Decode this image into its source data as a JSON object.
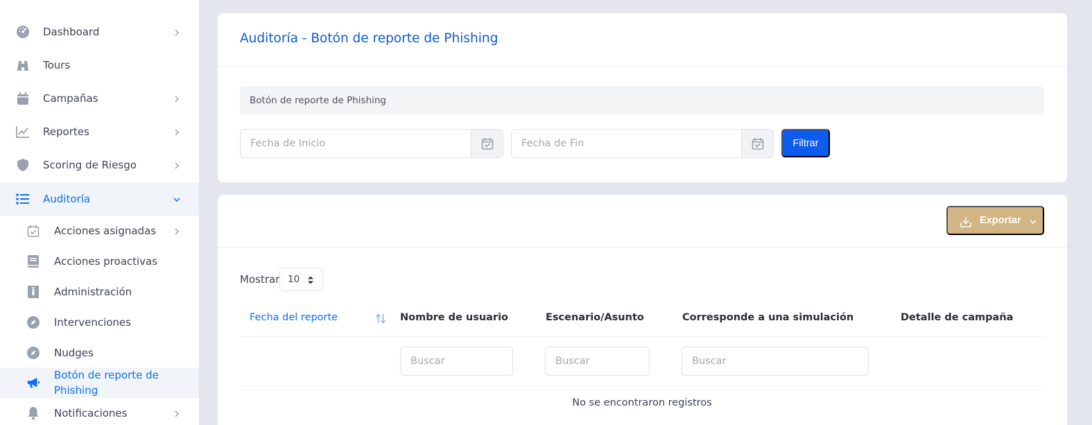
{
  "sidebar": {
    "items": [
      {
        "label": "Dashboard",
        "icon": "gauge-icon"
      },
      {
        "label": "Tours",
        "icon": "binoculars-icon"
      },
      {
        "label": "Campañas",
        "icon": "calendar-icon"
      },
      {
        "label": "Reportes",
        "icon": "line-chart-icon"
      },
      {
        "label": "Scoring de Riesgo",
        "icon": "shield-icon"
      },
      {
        "label": "Auditoría",
        "icon": "list-icon"
      }
    ],
    "subitems": [
      {
        "label": "Acciones asignadas",
        "icon": "calendar-check-icon"
      },
      {
        "label": "Acciones proactivas",
        "icon": "book-icon"
      },
      {
        "label": "Administración",
        "icon": "tie-icon"
      },
      {
        "label": "Intervenciones",
        "icon": "compass-icon"
      },
      {
        "label": "Nudges",
        "icon": "compass-icon"
      },
      {
        "label": "Botón de reporte de Phishing",
        "line1": "Botón de reporte de",
        "line2": "Phishing",
        "icon": "megaphone-icon"
      },
      {
        "label": "Notificaciones",
        "icon": "bell-icon"
      }
    ]
  },
  "header": {
    "title": "Auditoría - Botón de reporte de Phishing"
  },
  "filters": {
    "module_value": "Botón de reporte de Phishing",
    "start_placeholder": "Fecha de Inicio",
    "end_placeholder": "Fecha de Fin",
    "filter_button": "Filtrar"
  },
  "table_card": {
    "export_button": "Exportar",
    "show_label": "Mostrar",
    "page_length": "10",
    "columns": [
      "Fecha del reporte",
      "Nombre de usuario",
      "Escenario/Asunto",
      "Corresponde a una simulación",
      "Detalle de campaña"
    ],
    "search_placeholder": "Buscar",
    "empty_message": "No se encontraron registros"
  },
  "colors": {
    "accent": "#0d6efd",
    "filter_button": "#0d5cf0",
    "export_button": "#d1b584",
    "background": "#e4e6ed"
  }
}
